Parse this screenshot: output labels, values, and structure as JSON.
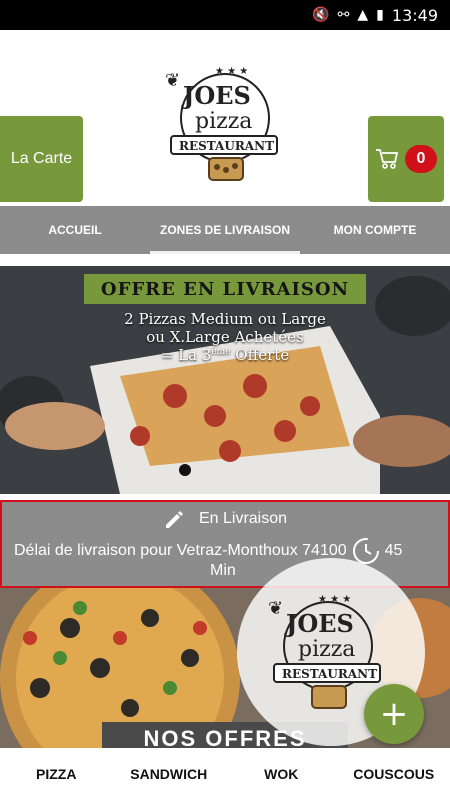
{
  "statusbar": {
    "time": "13:49",
    "icons": [
      "mute-icon",
      "wifi-icon",
      "signal-icon",
      "battery-icon"
    ]
  },
  "header": {
    "menu_label": "La Carte",
    "cart_count": "0",
    "logo": {
      "line1": "JOES",
      "line2": "pizza",
      "line3": "RESTAURANT"
    }
  },
  "tabs": [
    {
      "label": "ACCUEIL",
      "active": false
    },
    {
      "label": "ZONES DE LIVRAISON",
      "active": true
    },
    {
      "label": "MON COMPTE",
      "active": false
    }
  ],
  "banner": {
    "title": "OFFRE EN LIVRAISON",
    "line1": "2 Pizzas Medium ou Large",
    "line2": "ou X.Large Achetées",
    "line3_prefix": "= La 3",
    "line3_sup": "ème",
    "line3_suffix": " Offerte"
  },
  "delivery": {
    "mode": "En Livraison",
    "delay_text": "Délai de livraison pour Vetraz-Monthoux 74100",
    "delay_value": "45",
    "delay_unit": "Min"
  },
  "offers_label": "NOS OFFRES",
  "bottom_nav": [
    "PIZZA",
    "SANDWICH",
    "WOK",
    "COUSCOUS"
  ],
  "colors": {
    "accent": "#78983c",
    "badge": "#d0111c",
    "tabbar": "#8c8c8c"
  }
}
